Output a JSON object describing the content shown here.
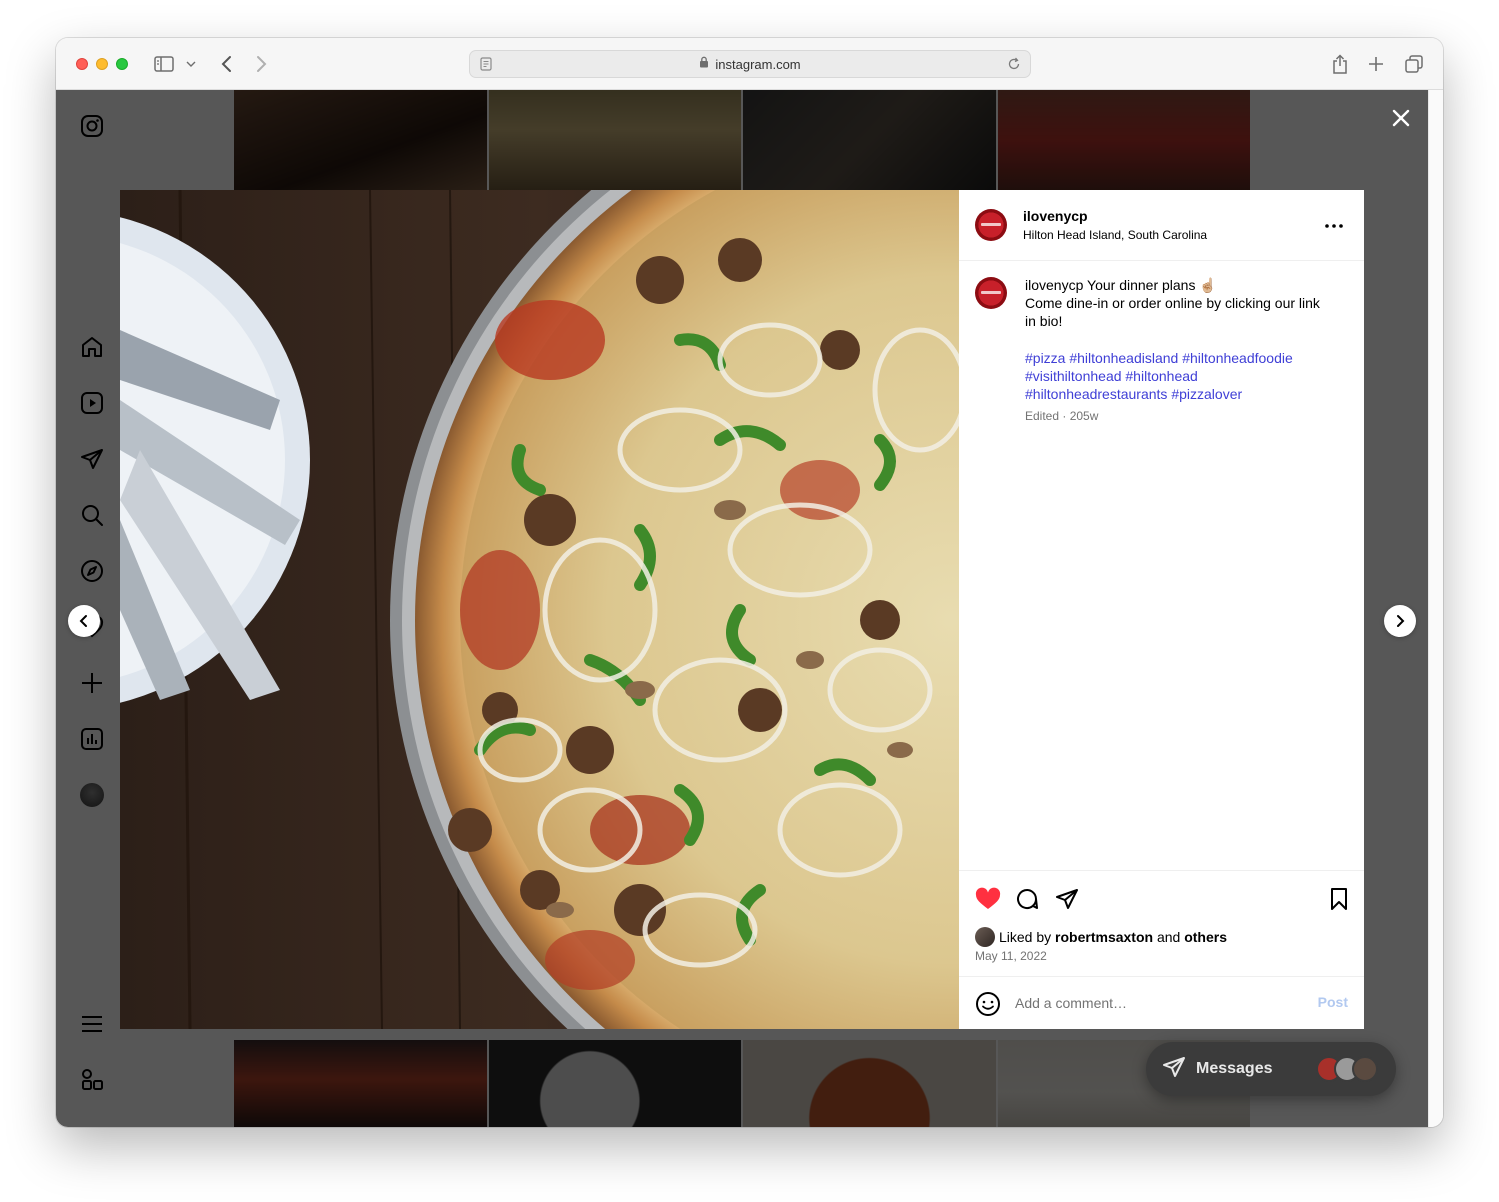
{
  "browser": {
    "url": "instagram.com"
  },
  "post": {
    "username": "ilovenycp",
    "location": "Hilton Head Island, South Carolina",
    "caption_user": "ilovenycp",
    "caption_line1": "Your dinner plans ☝🏼",
    "caption_line2": "Come dine-in or order online by clicking our link in bio!",
    "hashtags": "#pizza #hiltonheadisland #hiltonheadfoodie #visithiltonhead #hiltonhead #hiltonheadrestaurants #pizzalover",
    "edited": "Edited · 205w",
    "liked_by_prefix": "Liked by",
    "liked_by_user": "robertmsaxton",
    "liked_by_and": "and",
    "liked_by_others": "others",
    "date": "May 11, 2022",
    "liked": true
  },
  "comment": {
    "placeholder": "Add a comment…",
    "post_label": "Post"
  },
  "messages": {
    "label": "Messages"
  },
  "colors": {
    "like_red": "#ff3040",
    "hashtag_blue": "#3f3fd6",
    "post_disabled": "#b2c9f0"
  }
}
